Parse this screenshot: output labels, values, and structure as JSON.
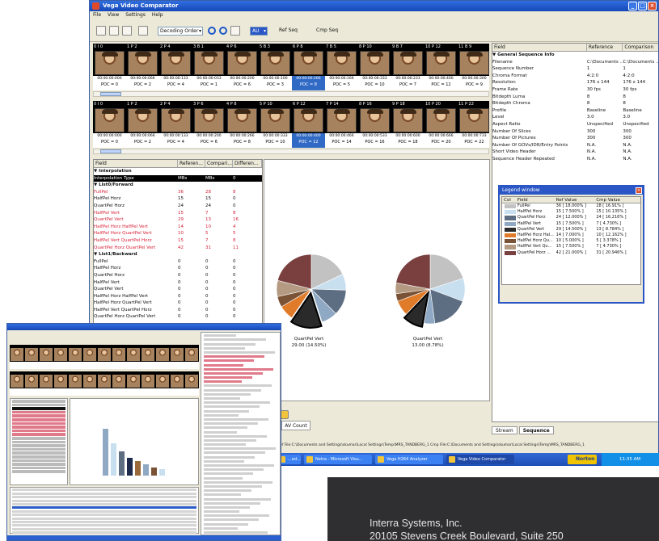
{
  "main_window": {
    "title": "Vega Video Comparator",
    "menu": [
      "File",
      "View",
      "Settings",
      "Help"
    ],
    "toolbar": {
      "order_select": "Decoding Order",
      "seq_select": "AU",
      "ref_seq_label": "Ref Seq",
      "cmp_seq_label": "Cmp Seq"
    },
    "strip1": [
      {
        "head": "0  I  0",
        "tc": "00:00:00:000",
        "poc": "POC = 0"
      },
      {
        "head": "1  P  2",
        "tc": "00:00:00:066",
        "poc": "POC = 2"
      },
      {
        "head": "2  P  4",
        "tc": "00:00:00:133",
        "poc": "POC = 4"
      },
      {
        "head": "3  B  1",
        "tc": "00:00:00:033",
        "poc": "POC = 1"
      },
      {
        "head": "4  P  6",
        "tc": "00:00:00:200",
        "poc": "POC = 6"
      },
      {
        "head": "5  B  3",
        "tc": "00:00:00:100",
        "poc": "POC = 3"
      },
      {
        "head": "6  P  8",
        "tc": "00:00:00:266",
        "poc": "POC = 8"
      },
      {
        "head": "7  B  5",
        "tc": "00:00:00:166",
        "poc": "POC = 5"
      },
      {
        "head": "8  P  10",
        "tc": "00:00:00:333",
        "poc": "POC = 10"
      },
      {
        "head": "9  B  7",
        "tc": "00:00:00:233",
        "poc": "POC = 7"
      },
      {
        "head": "10  P  12",
        "tc": "00:00:00:400",
        "poc": "POC = 12"
      },
      {
        "head": "11  B  9",
        "tc": "00:00:00:300",
        "poc": "POC = 9"
      }
    ],
    "strip2": [
      {
        "head": "0  I  0",
        "tc": "00:00:00:000",
        "poc": "POC = 0"
      },
      {
        "head": "1  P  2",
        "tc": "00:00:00:066",
        "poc": "POC = 2"
      },
      {
        "head": "2  P  4",
        "tc": "00:00:00:133",
        "poc": "POC = 4"
      },
      {
        "head": "3  P  6",
        "tc": "00:00:00:200",
        "poc": "POC = 6"
      },
      {
        "head": "4  P  8",
        "tc": "00:00:00:266",
        "poc": "POC = 8"
      },
      {
        "head": "5  P  10",
        "tc": "00:00:00:333",
        "poc": "POC = 10"
      },
      {
        "head": "6  P  12",
        "tc": "00:00:00:400",
        "poc": "POC = 12"
      },
      {
        "head": "7  P  14",
        "tc": "00:00:00:466",
        "poc": "POC = 14"
      },
      {
        "head": "8  P  16",
        "tc": "00:00:00:533",
        "poc": "POC = 16"
      },
      {
        "head": "9  P  18",
        "tc": "00:00:00:600",
        "poc": "POC = 18"
      },
      {
        "head": "10  P  20",
        "tc": "00:00:00:666",
        "poc": "POC = 20"
      },
      {
        "head": "11  P  22",
        "tc": "00:00:00:733",
        "poc": "POC = 22"
      }
    ],
    "grid": {
      "headers": [
        "Field",
        "Referen...",
        "Compari...",
        "Differen..."
      ],
      "rows": [
        {
          "c1": "▼ Interpolation",
          "c2": "",
          "c3": "",
          "c4": "",
          "kind": "grp"
        },
        {
          "c1": "   Interpolation Type",
          "c2": "MBs",
          "c3": "MBs",
          "c4": "0",
          "kind": "hl"
        },
        {
          "c1": " ▼ List0/Forward",
          "c2": "",
          "c3": "",
          "c4": "",
          "kind": "grp"
        },
        {
          "c1": "     FullPel",
          "c2": "36",
          "c3": "28",
          "c4": "8",
          "kind": "red"
        },
        {
          "c1": "     HalfPel Horz",
          "c2": "15",
          "c3": "15",
          "c4": "0",
          "kind": ""
        },
        {
          "c1": "     QuartPel Horz",
          "c2": "24",
          "c3": "24",
          "c4": "0",
          "kind": ""
        },
        {
          "c1": "     HalfPel Vert",
          "c2": "15",
          "c3": "7",
          "c4": "8",
          "kind": "red"
        },
        {
          "c1": "     QuartPel Vert",
          "c2": "29",
          "c3": "13",
          "c4": "16",
          "kind": "red"
        },
        {
          "c1": "     HalfPel Horz HalfPel Vert",
          "c2": "14",
          "c3": "10",
          "c4": "4",
          "kind": "red"
        },
        {
          "c1": "     HalfPel Horz QuartPel Vert",
          "c2": "10",
          "c3": "5",
          "c4": "5",
          "kind": "red"
        },
        {
          "c1": "     HalfPel Vert QuartPel Horz",
          "c2": "15",
          "c3": "7",
          "c4": "8",
          "kind": "red"
        },
        {
          "c1": "     QuartPel Horz QuartPel Vert",
          "c2": "42",
          "c3": "31",
          "c4": "11",
          "kind": "red"
        },
        {
          "c1": " ▼ List1/Backward",
          "c2": "",
          "c3": "",
          "c4": "",
          "kind": "grp"
        },
        {
          "c1": "     FullPel",
          "c2": "0",
          "c3": "0",
          "c4": "0",
          "kind": ""
        },
        {
          "c1": "     HalfPel Horz",
          "c2": "0",
          "c3": "0",
          "c4": "0",
          "kind": ""
        },
        {
          "c1": "     QuartPel Horz",
          "c2": "0",
          "c3": "0",
          "c4": "0",
          "kind": ""
        },
        {
          "c1": "     HalfPel Vert",
          "c2": "0",
          "c3": "0",
          "c4": "0",
          "kind": ""
        },
        {
          "c1": "     QuartPel Vert",
          "c2": "0",
          "c3": "0",
          "c4": "0",
          "kind": ""
        },
        {
          "c1": "     HalfPel Horz HalfPel Vert",
          "c2": "0",
          "c3": "0",
          "c4": "0",
          "kind": ""
        },
        {
          "c1": "     HalfPel Horz QuartPel Vert",
          "c2": "0",
          "c3": "0",
          "c4": "0",
          "kind": ""
        },
        {
          "c1": "     HalfPel Vert QuartPel Horz",
          "c2": "0",
          "c3": "0",
          "c4": "0",
          "kind": ""
        },
        {
          "c1": "     QuartPel Horz QuartPel Vert",
          "c2": "0",
          "c3": "0",
          "c4": "0",
          "kind": ""
        }
      ]
    },
    "properties": {
      "headers": [
        "Field",
        "Reference",
        "Comparison"
      ],
      "rows": [
        [
          "▼ General Sequence Info",
          "",
          ""
        ],
        [
          "   Filename",
          "C:\\Documents ...",
          "C:\\Documents ..."
        ],
        [
          "   Sequence Number",
          "1",
          "1"
        ],
        [
          "   Chroma Format",
          "4:2:0",
          "4:2:0"
        ],
        [
          "   Resolution",
          "176 x 144",
          "176 x 144"
        ],
        [
          "   Frame Rate",
          "30 fps",
          "30 fps"
        ],
        [
          "   Bitdepth Luma",
          "8",
          "8"
        ],
        [
          "   Bitdepth Chroma",
          "8",
          "8"
        ],
        [
          "   Profile",
          "Baseline",
          "Baseline"
        ],
        [
          "   Level",
          "3.0",
          "3.0"
        ],
        [
          "   Aspect Ratio",
          "Unspecified",
          "Unspecified"
        ],
        [
          "   Number Of Slices",
          "300",
          "300"
        ],
        [
          "   Number Of Pictures",
          "300",
          "300"
        ],
        [
          "   Number Of GOVs/IDR/Entry Points",
          "N.A.",
          "N.A."
        ],
        [
          "   Short Video Header",
          "N.A.",
          "N.A."
        ],
        [
          "   Sequence Header Repeated",
          "N.A.",
          "N.A."
        ]
      ]
    },
    "legend": {
      "title": "Legend window",
      "headers": [
        "Col",
        "Field",
        "Ref Value",
        "Cmp Value"
      ],
      "rows": [
        {
          "color": "#c2c2c2",
          "field": "FullPel",
          "ref": "36 [ 18.000% ]",
          "cmp": "28 [ 16.91% ]"
        },
        {
          "color": "#c8dff0",
          "field": "HalfPel Horz",
          "ref": "15 [ 7.500% ]",
          "cmp": "15 [ 10.135% ]"
        },
        {
          "color": "#5e6e82",
          "field": "QuartPel Horz",
          "ref": "24 [ 12.000% ]",
          "cmp": "24 [ 16.216% ]"
        },
        {
          "color": "#8fa9c4",
          "field": "HalfPel Vert",
          "ref": "15 [ 7.500% ]",
          "cmp": "7 [ 4.730% ]"
        },
        {
          "color": "#2a2a2a",
          "field": "QuartPel Vert",
          "ref": "29 [ 14.500% ]",
          "cmp": "13 [ 8.784% ]"
        },
        {
          "color": "#e07b2a",
          "field": "HalfPel Horz Hal...",
          "ref": "14 [ 7.000% ]",
          "cmp": "10 [ 12.162% ]"
        },
        {
          "color": "#7a5236",
          "field": "HalfPel Horz Qu...",
          "ref": "10 [ 5.000% ]",
          "cmp": "5 [ 3.378% ]"
        },
        {
          "color": "#b49a82",
          "field": "HalfPel Vert Qu...",
          "ref": "15 [ 7.500% ]",
          "cmp": "7 [ 4.730% ]"
        },
        {
          "color": "#7a4040",
          "field": "QuartPel Horz ...",
          "ref": "42 [ 21.000% ]",
          "cmp": "31 [ 20.946% ]"
        }
      ]
    },
    "pie_captions": {
      "left_title": "QuartPel Vert",
      "left_value": "29.00 (14.50%)",
      "right_title": "QuartPel Vert",
      "right_value": "13.00 (8.78%)"
    },
    "av_count": "AV Count",
    "tabs": [
      "Stream",
      "Sequence"
    ],
    "status_line": "Ref File:C:\\Documents and Settings\\skumar\\Local Settings\\Temp\\MRS_TANDBERG_1 Cmp File:C:\\Documents and Settings\\skumar\\Local Settings\\Temp\\MRS_TANDBERG_1"
  },
  "taskbar": {
    "items": [
      "...ed...",
      "Netra - Microsoft Visu...",
      "Vega H264 Analyzer",
      "Vega Video Comparator"
    ],
    "norton": "Norton",
    "clock": "11:35 AM"
  },
  "chart_data": {
    "type": "pie",
    "categories": [
      "FullPel",
      "HalfPel Horz",
      "QuartPel Horz",
      "HalfPel Vert",
      "QuartPel Vert",
      "HalfPel Horz Hal...",
      "HalfPel Horz Qu...",
      "HalfPel Vert Qu...",
      "QuartPel Horz ..."
    ],
    "series": [
      {
        "name": "Ref Value",
        "values": [
          36,
          15,
          24,
          15,
          29,
          14,
          10,
          15,
          42
        ]
      },
      {
        "name": "Cmp Value",
        "values": [
          28,
          15,
          24,
          7,
          13,
          10,
          5,
          7,
          31
        ]
      }
    ],
    "colors": [
      "#c2c2c2",
      "#c8dff0",
      "#5e6e82",
      "#8fa9c4",
      "#2a2a2a",
      "#e07b2a",
      "#7a5236",
      "#b49a82",
      "#7a4040"
    ],
    "highlighted": "QuartPel Vert"
  },
  "contact": {
    "company": "Interra Systems, Inc.",
    "address": "20105 Stevens Creek Boulevard, Suite 250"
  }
}
